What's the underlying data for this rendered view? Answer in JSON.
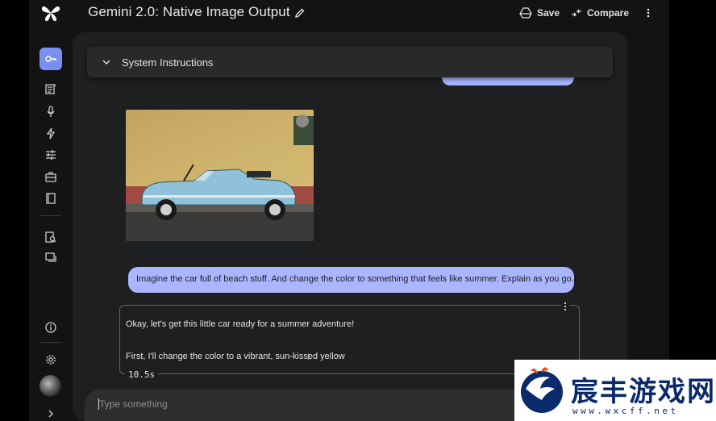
{
  "header": {
    "title": "Gemini 2.0: Native Image Output",
    "save_label": "Save",
    "compare_label": "Compare"
  },
  "sidebar": {
    "items": [
      {
        "name": "key-icon",
        "active": true
      },
      {
        "name": "chat-prompt-icon"
      },
      {
        "name": "microphone-icon"
      },
      {
        "name": "lightning-icon"
      },
      {
        "name": "tune-icon"
      },
      {
        "name": "briefcase-icon"
      },
      {
        "name": "book-icon"
      },
      {
        "name": "document-search-icon"
      },
      {
        "name": "chat-bubbles-icon"
      },
      {
        "name": "info-icon"
      },
      {
        "name": "gear-icon"
      },
      {
        "name": "chevron-right-icon"
      }
    ]
  },
  "system_instructions": {
    "label": "System Instructions"
  },
  "chat": {
    "user_message": "Imagine the car full of beach stuff. And change the color to something that feels like summer. Explain as you go.",
    "response_line_1": "Okay, let's get this little car ready for a summer adventure!",
    "response_line_2": "First, I'll change the color to a vibrant, sun-kissed yellow",
    "elapsed": "10.5s"
  },
  "prompt": {
    "placeholder": "Type something"
  },
  "watermark": {
    "name": "宸丰游戏网",
    "url": "www.wxcff.net"
  },
  "colors": {
    "accent": "#7a8ff2",
    "user_bubble": "#aab6ff",
    "panel": "#1e1f20",
    "background": "#131314"
  }
}
